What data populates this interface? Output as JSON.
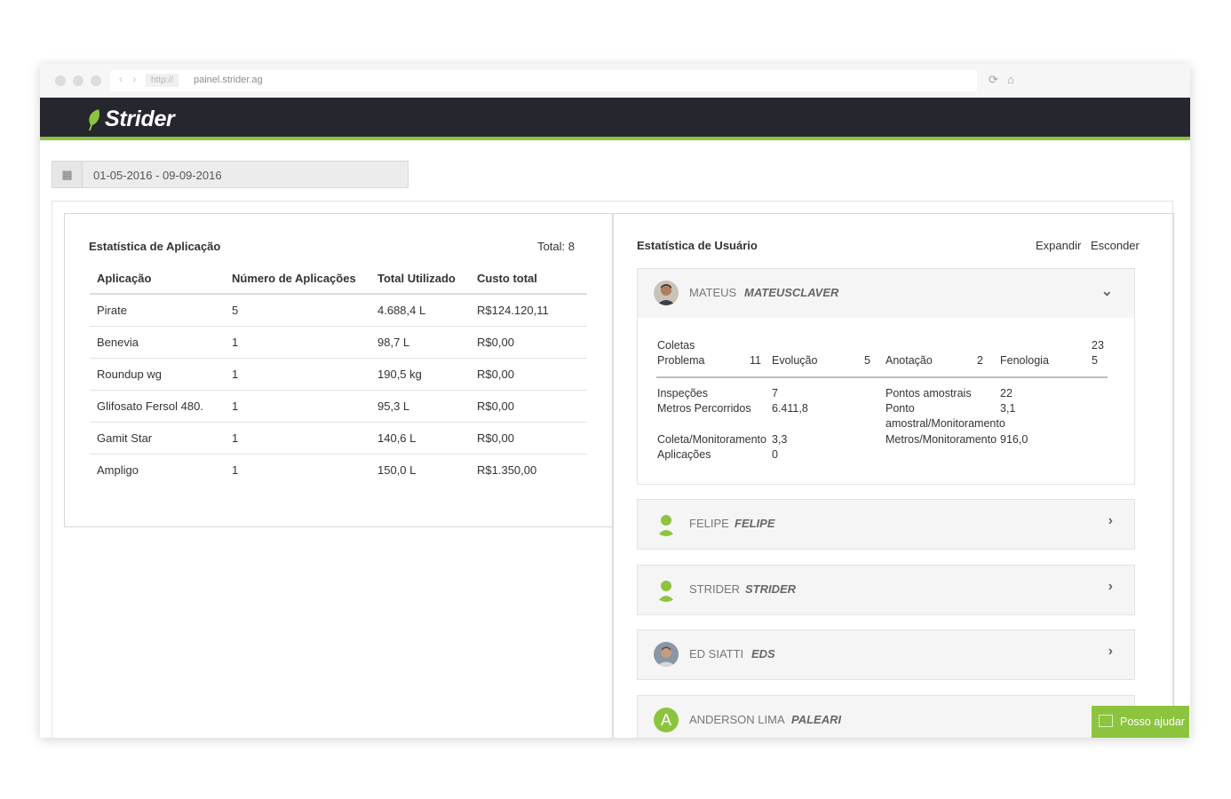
{
  "browser": {
    "protocol": "http://",
    "url": "painel.strider.ag"
  },
  "app": {
    "logo_text": "Strider",
    "brand_color": "#8cc43f",
    "header_color": "#25262e"
  },
  "filter": {
    "date_range": "01-05-2016 - 09-09-2016"
  },
  "app_stats": {
    "title": "Estatística de Aplicação",
    "total_label": "Total: 8",
    "columns": [
      "Aplicação",
      "Número de Aplicações",
      "Total Utilizado",
      "Custo total"
    ],
    "rows": [
      [
        "Pirate",
        "5",
        "4.688,4 L",
        "R$124.120,11"
      ],
      [
        "Benevia",
        "1",
        "98,7 L",
        "R$0,00"
      ],
      [
        "Roundup wg",
        "1",
        "190,5 kg",
        "R$0,00"
      ],
      [
        "Glifosato Fersol 480.",
        "1",
        "95,3 L",
        "R$0,00"
      ],
      [
        "Gamit Star",
        "1",
        "140,6 L",
        "R$0,00"
      ],
      [
        "Ampligo",
        "1",
        "150,0 L",
        "R$1.350,00"
      ]
    ]
  },
  "user_stats": {
    "title": "Estatística de Usuário",
    "expand_label": "Expandir",
    "hide_label": "Esconder",
    "users": [
      {
        "name": "MATEUS",
        "login": "MATEUSCLAVER",
        "avatar": "photo-avatar",
        "expanded": true
      },
      {
        "name": "FELIPE",
        "login": "FELIPE",
        "avatar": "default-avatar",
        "expanded": false
      },
      {
        "name": "STRIDER",
        "login": "STRIDER",
        "avatar": "default-avatar",
        "expanded": false
      },
      {
        "name": "ED SIATTI",
        "login": "EDS",
        "avatar": "photo-avatar",
        "expanded": false
      },
      {
        "name": "ANDERSON LIMA",
        "login": "PALEARI",
        "avatar": "letter-avatar",
        "avatar_letter": "A",
        "expanded": false
      }
    ],
    "detail": {
      "coletas_label": "Coletas",
      "coletas_value": "23",
      "problema_label": "Problema",
      "problema_value": "11",
      "evolucao_label": "Evolução",
      "evolucao_value": "5",
      "anotacao_label": "Anotação",
      "anotacao_value": "2",
      "fenologia_label": "Fenologia",
      "fenologia_value": "5",
      "inspecoes_label": "Inspeções",
      "inspecoes_value": "7",
      "metros_label": "Metros Percorridos",
      "metros_value": "6.411,8",
      "pontos_label": "Pontos amostrais",
      "pontos_value": "22",
      "ponto_mon_label_1": "Ponto",
      "ponto_mon_label_2": "amostral/Monitoramento",
      "ponto_mon_value": "3,1",
      "coleta_mon_label": "Coleta/Monitoramento",
      "coleta_mon_value": "3,3",
      "metros_mon_label": "Metros/Monitoramento",
      "metros_mon_value": "916,0",
      "aplicacoes_label": "Aplicações",
      "aplicacoes_value": "0"
    }
  },
  "help": {
    "label": "Posso ajudar"
  }
}
